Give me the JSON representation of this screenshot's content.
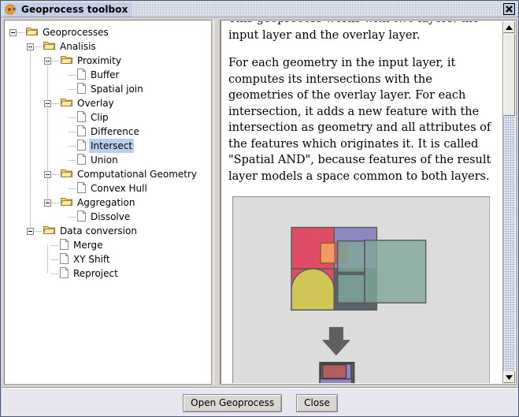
{
  "window": {
    "title": "Geoprocess toolbox",
    "app_icon": "geoprocess-globe-icon",
    "close_label": "×"
  },
  "tree": {
    "nodes": [
      {
        "label": "Geoprocesses",
        "depth": 0,
        "type": "folder",
        "expanded": true,
        "selected": false
      },
      {
        "label": "Analisis",
        "depth": 1,
        "type": "folder",
        "expanded": true,
        "selected": false
      },
      {
        "label": "Proximity",
        "depth": 2,
        "type": "folder",
        "expanded": true,
        "selected": false
      },
      {
        "label": "Buffer",
        "depth": 3,
        "type": "leaf",
        "expanded": false,
        "selected": false
      },
      {
        "label": "Spatial join",
        "depth": 3,
        "type": "leaf",
        "expanded": false,
        "selected": false
      },
      {
        "label": "Overlay",
        "depth": 2,
        "type": "folder",
        "expanded": true,
        "selected": false
      },
      {
        "label": "Clip",
        "depth": 3,
        "type": "leaf",
        "expanded": false,
        "selected": false
      },
      {
        "label": "Difference",
        "depth": 3,
        "type": "leaf",
        "expanded": false,
        "selected": false
      },
      {
        "label": "Intersect",
        "depth": 3,
        "type": "leaf",
        "expanded": false,
        "selected": true
      },
      {
        "label": "Union",
        "depth": 3,
        "type": "leaf",
        "expanded": false,
        "selected": false
      },
      {
        "label": "Computational Geometry",
        "depth": 2,
        "type": "folder",
        "expanded": true,
        "selected": false
      },
      {
        "label": "Convex Hull",
        "depth": 3,
        "type": "leaf",
        "expanded": false,
        "selected": false
      },
      {
        "label": "Aggregation",
        "depth": 2,
        "type": "folder",
        "expanded": true,
        "selected": false
      },
      {
        "label": "Dissolve",
        "depth": 3,
        "type": "leaf",
        "expanded": false,
        "selected": false
      },
      {
        "label": "Data conversion",
        "depth": 1,
        "type": "folder",
        "expanded": true,
        "selected": false
      },
      {
        "label": "Merge",
        "depth": 2,
        "type": "leaf",
        "expanded": false,
        "selected": false
      },
      {
        "label": "XY Shift",
        "depth": 2,
        "type": "leaf",
        "expanded": false,
        "selected": false
      },
      {
        "label": "Reproject",
        "depth": 2,
        "type": "leaf",
        "expanded": false,
        "selected": false
      }
    ]
  },
  "description": {
    "paragraph1": "This geoprocess works with two layers: the input layer and the overlay layer.",
    "paragraph2": "For each geometry in the input layer, it computes its intersections with the geometries of the overlay layer. For each intersection, it adds a new feature with the intersection as geometry and all attributes of the features which originates it. It is called \"Spatial AND\", because features of the result layer models a space common to both layers."
  },
  "figure": {
    "name": "intersect-diagram",
    "arrow_icon": "down-arrow-icon",
    "background": "#dcdcdc",
    "input_layer": {
      "quadrants": [
        {
          "name": "red-quadrant",
          "color": "#e04c64"
        },
        {
          "name": "purple-quadrant",
          "color": "#8d87c4"
        },
        {
          "name": "yellow-quadrant",
          "color": "#cfc655"
        },
        {
          "name": "gray-quadrant",
          "color": "#58646a"
        }
      ],
      "small_box_color": "#f29a62"
    },
    "overlay_layer": {
      "color": "#7fa79b",
      "opacity": 0.72,
      "stroke": "#5a5a5a"
    },
    "result_layer": {
      "shapes": [
        {
          "name": "result-red",
          "color": "#b05e5e"
        },
        {
          "name": "result-purple",
          "color": "#8d87c4"
        },
        {
          "name": "result-gray-1",
          "color": "#58646a"
        },
        {
          "name": "result-gray-2",
          "color": "#58646a"
        }
      ]
    }
  },
  "scrollbar": {
    "up_icon": "triangle-up-icon",
    "down_icon": "triangle-down-icon",
    "thumb": "scrollbar-thumb"
  },
  "buttons": {
    "open": "Open Geoprocess",
    "close": "Close"
  }
}
